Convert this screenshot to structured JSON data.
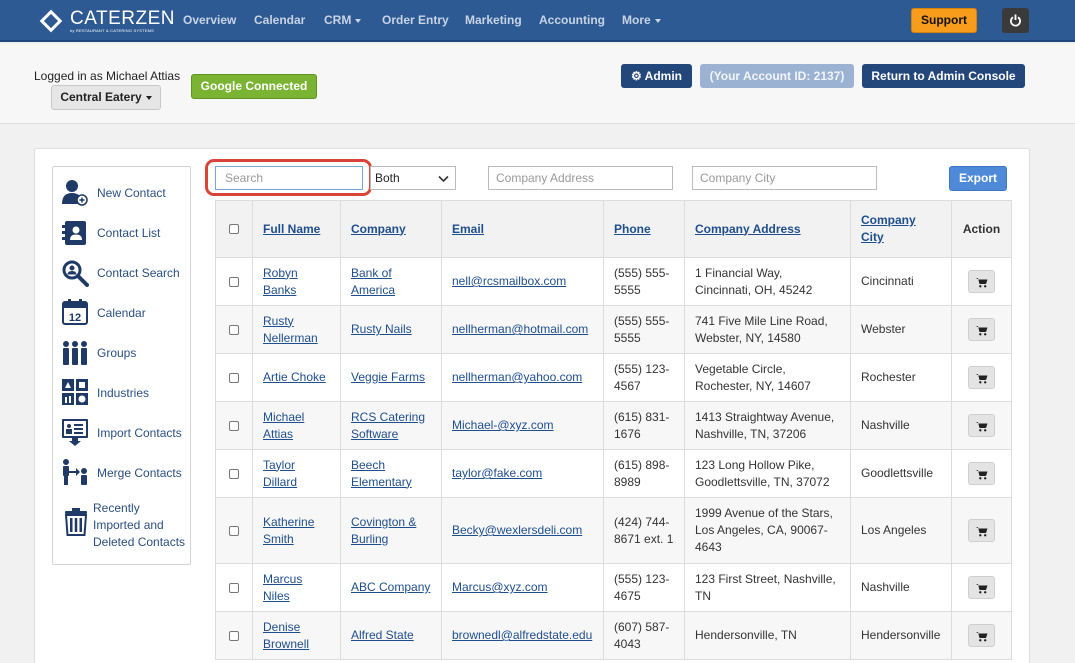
{
  "brand": {
    "name": "CATERZEN",
    "tagline": "by RESTAURANT & CATERING SYSTEMS"
  },
  "nav": {
    "items": [
      {
        "label": "Overview"
      },
      {
        "label": "Calendar"
      },
      {
        "label": "CRM"
      },
      {
        "label": "Order Entry"
      },
      {
        "label": "Marketing"
      },
      {
        "label": "Accounting"
      },
      {
        "label": "More"
      }
    ],
    "support_label": "Support"
  },
  "account": {
    "logged_in_text": "Logged in as Michael Attias",
    "location": "Central Eatery",
    "google_label": "Google Connected",
    "admin_label": "Admin",
    "account_id_label": "(Your Account ID: 2137)",
    "console_label": "Return to Admin Console"
  },
  "sidebar": {
    "items": [
      {
        "label": "New Contact",
        "icon": "new-contact-icon"
      },
      {
        "label": "Contact List",
        "icon": "contact-list-icon"
      },
      {
        "label": "Contact Search",
        "icon": "magnifier-icon"
      },
      {
        "label": "Calendar",
        "icon": "calendar-icon"
      },
      {
        "label": "Groups",
        "icon": "groups-icon"
      },
      {
        "label": "Industries",
        "icon": "industries-icon"
      },
      {
        "label": "Import Contacts",
        "icon": "import-icon"
      },
      {
        "label": "Merge Contacts",
        "icon": "merge-icon"
      },
      {
        "label": "Recently Imported and Deleted Contacts",
        "icon": "trash-icon"
      }
    ],
    "calendar_day": "12"
  },
  "filters": {
    "search_placeholder": "Search",
    "scope_value": "Both",
    "address_placeholder": "Company Address",
    "city_placeholder": "Company City",
    "export_label": "Export"
  },
  "table": {
    "headers": {
      "full_name": "Full Name",
      "company": "Company",
      "email": "Email",
      "phone": "Phone",
      "address": "Company Address",
      "city": "Company City",
      "action": "Action"
    },
    "rows": [
      {
        "name": "Robyn Banks",
        "company": "Bank of America",
        "email": "nell@rcsmailbox.com",
        "phone": "(555) 555-5555",
        "address": "1 Financial Way, Cincinnati, OH, 45242",
        "city": "Cincinnati"
      },
      {
        "name": "Rusty Nellerman",
        "company": "Rusty Nails",
        "email": "nellherman@hotmail.com",
        "phone": "(555) 555-5555",
        "address": "741 Five Mile Line Road, Webster, NY, 14580",
        "city": "Webster"
      },
      {
        "name": "Artie Choke",
        "company": "Veggie Farms",
        "email": "nellherman@yahoo.com",
        "phone": "(555) 123-4567",
        "address": "Vegetable Circle, Rochester, NY, 14607",
        "city": "Rochester"
      },
      {
        "name": "Michael Attias",
        "company": "RCS Catering Software",
        "email": "Michael-@xyz.com",
        "phone": "(615) 831-1676",
        "address": "1413 Straightway Avenue, Nashville, TN, 37206",
        "city": "Nashville"
      },
      {
        "name": "Taylor Dillard",
        "company": "Beech Elementary",
        "email": "taylor@fake.com",
        "phone": "(615) 898-8989",
        "address": "123 Long Hollow Pike, Goodlettsville, TN, 37072",
        "city": "Goodlettsville"
      },
      {
        "name": "Katherine Smith",
        "company": "Covington & Burling",
        "email": "Becky@wexlersdeli.com",
        "phone": "(424) 744-8671 ext. 1",
        "address": "1999 Avenue of the Stars, Los Angeles, CA, 90067-4643",
        "city": "Los Angeles"
      },
      {
        "name": "Marcus Niles",
        "company": "ABC Company",
        "email": "Marcus@xyz.com",
        "phone": "(555) 123-4675",
        "address": "123 First Street, Nashville, TN",
        "city": "Nashville"
      },
      {
        "name": "Denise Brownell",
        "company": "Alfred State",
        "email": "brownedl@alfredstate.edu",
        "phone": "(607) 587-4043",
        "address": "Hendersonville, TN",
        "city": "Hendersonville"
      }
    ]
  },
  "colors": {
    "nav_bg": "#2e5a93",
    "support": "#f89c1c",
    "google": "#7ab432",
    "admin": "#23477a",
    "highlight": "#d9443a",
    "link": "#1f4e8c"
  }
}
